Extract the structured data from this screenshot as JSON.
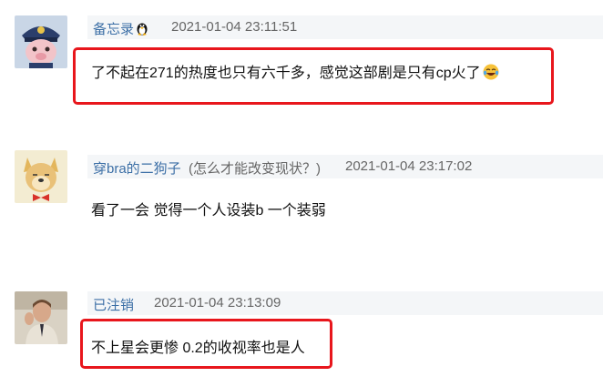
{
  "comments": [
    {
      "username": "备忘录",
      "user_badge_icon": "penguin-icon",
      "timestamp": "2021-01-04 23:11:51",
      "text": "了不起在271的热度也只有六千多，感觉这部剧是只有cp火了",
      "emoji_icon": "laughing-tears-emoji-icon",
      "highlight_color": "#e8161c"
    },
    {
      "username": "穿bra的二狗子",
      "signature": "(怎么才能改变现状？)",
      "timestamp": "2021-01-04 23:17:02",
      "text": "看了一会 觉得一个人设装b 一个装弱"
    },
    {
      "username": "已注销",
      "timestamp": "2021-01-04 23:13:09",
      "text": "不上星会更惨 0.2的收视率也是人",
      "highlight_color": "#e8161c"
    }
  ],
  "colors": {
    "username": "#3c6fa6",
    "meta_background": "#f4f6f8",
    "timestamp": "#666666"
  }
}
